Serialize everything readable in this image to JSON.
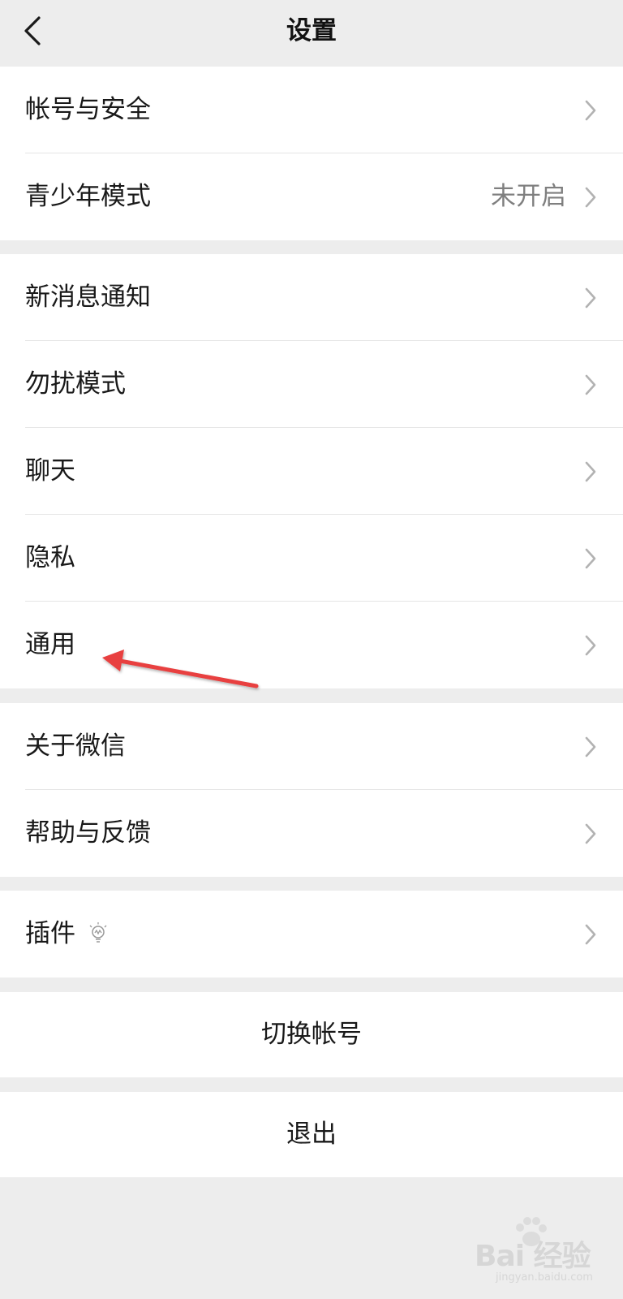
{
  "header": {
    "title": "设置",
    "back_icon": "chevron-left-icon"
  },
  "groups": [
    {
      "items": [
        {
          "label": "帐号与安全"
        },
        {
          "label": "青少年模式",
          "value": "未开启"
        }
      ]
    },
    {
      "items": [
        {
          "label": "新消息通知"
        },
        {
          "label": "勿扰模式"
        },
        {
          "label": "聊天"
        },
        {
          "label": "隐私"
        },
        {
          "label": "通用"
        }
      ]
    },
    {
      "items": [
        {
          "label": "关于微信"
        },
        {
          "label": "帮助与反馈"
        }
      ]
    },
    {
      "items": [
        {
          "label": "插件",
          "icon": "lightbulb-icon"
        }
      ]
    }
  ],
  "actions": {
    "switch_account": "切换帐号",
    "logout": "退出"
  },
  "annotation": {
    "arrow_color": "#e8403f",
    "target": "通用"
  },
  "watermark": {
    "text": "Bai 经验",
    "subtext": "jingyan.baidu.com"
  },
  "colors": {
    "background": "#ededed",
    "card": "#ffffff",
    "secondary_text": "#7f7f7f"
  }
}
